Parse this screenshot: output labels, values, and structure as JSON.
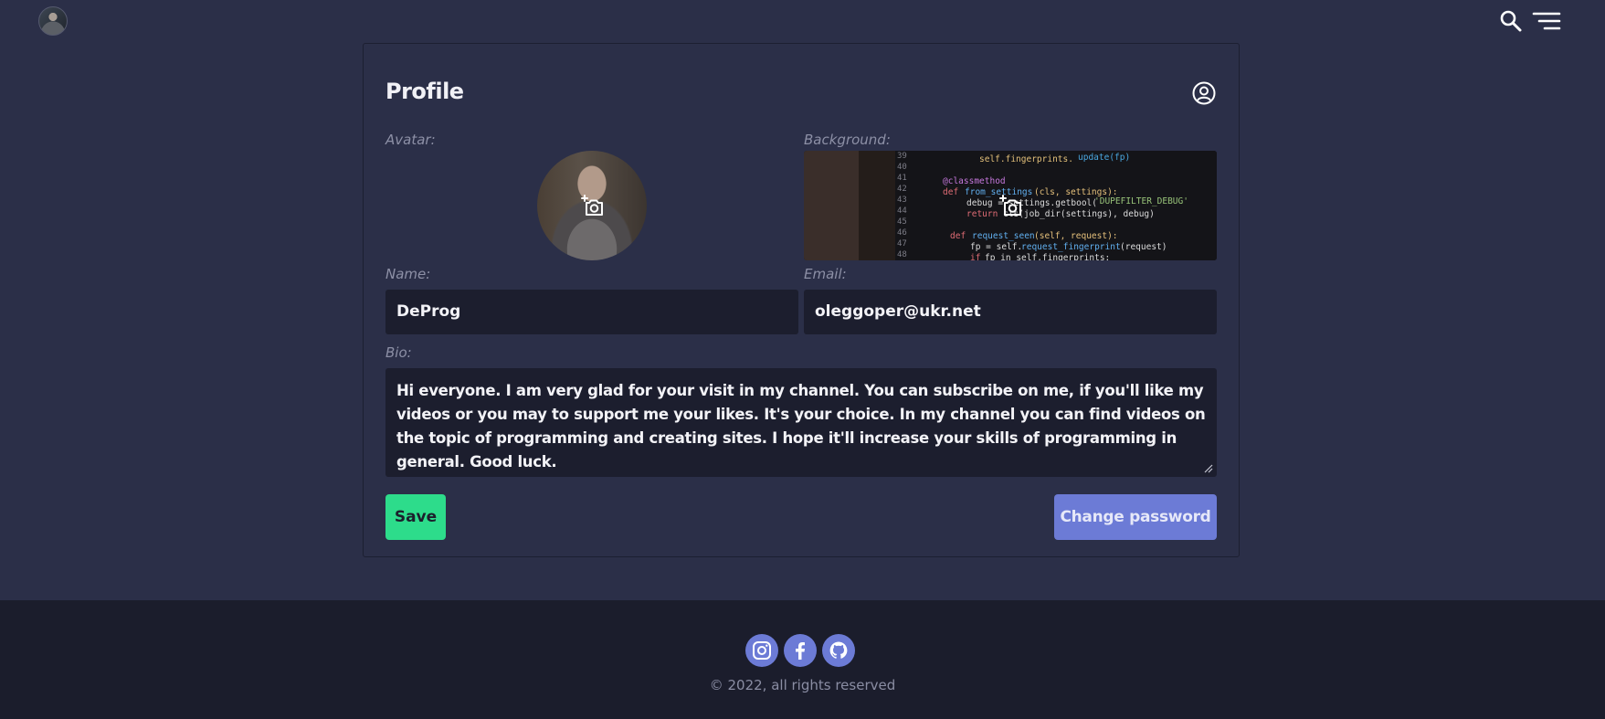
{
  "header": {
    "avatar_icon": "user-avatar",
    "search_icon": "search-icon",
    "menu_icon": "menu-icon"
  },
  "profile": {
    "title": "Profile",
    "title_icon": "user-circle-icon",
    "avatar_label": "Avatar:",
    "background_label": "Background:",
    "name_label": "Name:",
    "name_value": "DeProg",
    "email_label": "Email:",
    "email_value": "oleggoper@ukr.net",
    "bio_label": "Bio:",
    "bio_value": "Hi everyone. I am very glad for your visit in my channel. You can subscribe on me, if you'll like my videos or you may to support me your likes. It's your choice. In my channel you can find videos on the topic of programming and creating sites. I hope it'll increase your skills of programming in general. Good luck.",
    "save_label": "Save",
    "change_password_label": "Change password"
  },
  "footer": {
    "social": [
      {
        "icon": "instagram-icon"
      },
      {
        "icon": "facebook-icon"
      },
      {
        "icon": "github-icon"
      }
    ],
    "copyright": "© 2022, all rights reserved"
  },
  "colors": {
    "background": "#2b2f48",
    "footer": "#1b1d2c",
    "input": "#1c1e2e",
    "save": "#2ddc8b",
    "accent": "#6c7bd6"
  }
}
